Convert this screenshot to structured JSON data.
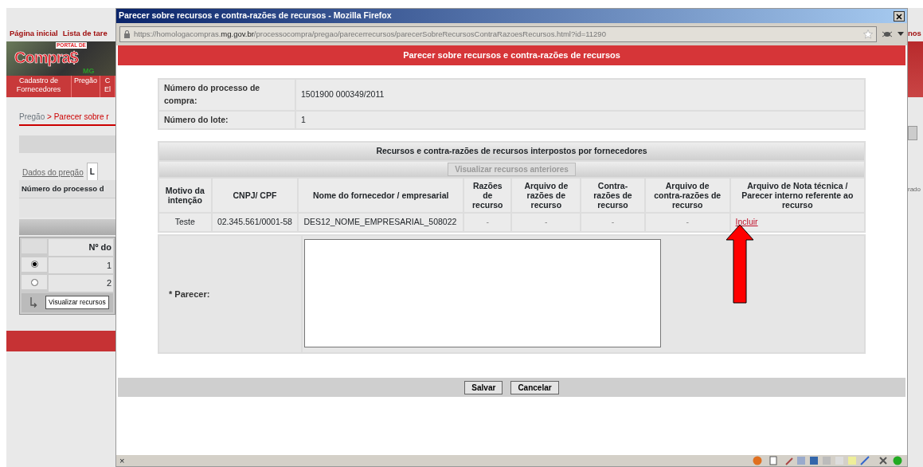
{
  "background_page": {
    "nav_links": [
      "Página inicial",
      "Lista de tare"
    ],
    "right_fragment": "nos",
    "logo": {
      "top": "PORTAL DE",
      "main": "Compra$",
      "sub": "MG"
    },
    "menu": [
      "Cadastro de Fornecedores",
      "Pregão",
      "C El"
    ],
    "breadcrumb": {
      "parent": "Pregão",
      "current": "> Parecer sobre r"
    },
    "tabs": [
      {
        "label": "Dados do pregão",
        "selected": false
      },
      {
        "label": "L",
        "selected": true
      }
    ],
    "header_cell": "Número do processo d",
    "grid": {
      "column": "Nº do",
      "rows": [
        {
          "value": "1",
          "selected": true
        },
        {
          "value": "2",
          "selected": false
        }
      ],
      "button": "Visualizar recursos"
    },
    "right_label": "rado"
  },
  "popup": {
    "title": "Parecer sobre recursos e contra-razões de recursos - Mozilla Firefox",
    "url": {
      "prefix": "https://homologacompras.",
      "domain": "mg.gov.br",
      "path": "/processocompra/pregao/parecerrecursos/parecerSobreRecursosContraRazoesRecursos.html?id=11290"
    },
    "page_title": "Parecer sobre recursos e contra-razões de recursos",
    "info": [
      {
        "label": "Número do processo de compra:",
        "value": "1501900 000349/2011"
      },
      {
        "label": "Número do lote:",
        "value": "1"
      }
    ],
    "table": {
      "title": "Recursos e contra-razões de recursos interpostos por fornecedores",
      "history_button": "Visualizar recursos anteriores",
      "columns": [
        "Motivo da intenção",
        "CNPJ/ CPF",
        "Nome do fornecedor / empresarial",
        "Razões de recurso",
        "Arquivo de razões de recurso",
        "Contra-razões de recurso",
        "Arquivo de contra-razões de recurso",
        "Arquivo de Nota técnica / Parecer interno referente ao recurso"
      ],
      "rows": [
        {
          "cells": [
            "Teste",
            "02.345.561/0001-58",
            "DES12_NOME_EMPRESARIAL_508022",
            "-",
            "-",
            "-",
            "-"
          ],
          "link": "Incluir"
        }
      ]
    },
    "parecer_label": "* Parecer:",
    "buttons": [
      "Salvar",
      "Cancelar"
    ],
    "status_close": "×"
  }
}
